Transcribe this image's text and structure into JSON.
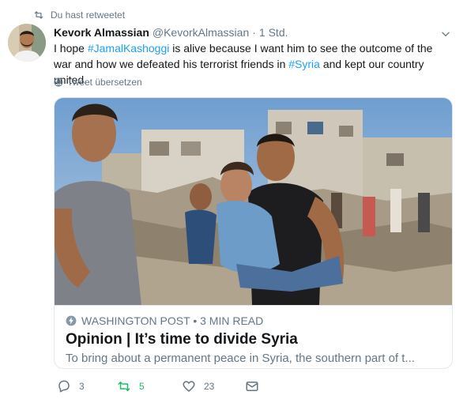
{
  "retweet_context": {
    "label": "Du hast retweetet"
  },
  "tweet": {
    "author_name": "Kevork Almassian",
    "author_handle": "@KevorkAlmassian",
    "separator": "·",
    "timestamp": "1 Std.",
    "text_parts": {
      "p1": "I hope ",
      "h1": "#JamalKashoggi",
      "p2": " is alive because I want him to see the outcome of the war and how we defeated his terrorist friends in ",
      "h2": "#Syria",
      "p3": " and kept our country united."
    },
    "translate_label": "Tweet übersetzen"
  },
  "card": {
    "source": "WASHINGTON POST • 3 MIN READ",
    "title": "Opinion | It’s time to divide Syria",
    "description": "To bring about a permanent peace in Syria, the southern part of t..."
  },
  "actions": {
    "reply_count": "3",
    "retweet_count": "5",
    "like_count": "23"
  },
  "colors": {
    "link": "#1da1f2",
    "retweeted": "#17bf63",
    "muted": "#657786"
  },
  "icons": [
    "retweet-icon",
    "chevron-down-icon",
    "globe-icon",
    "lightning-icon",
    "reply-icon",
    "heart-icon",
    "envelope-icon"
  ]
}
